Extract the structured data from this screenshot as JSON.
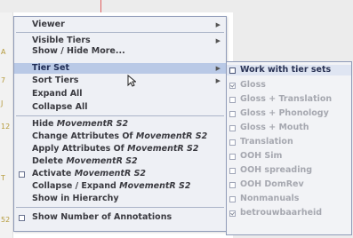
{
  "background": {
    "strip_marks": [
      "A",
      "7",
      "J",
      "12",
      "T",
      "52"
    ]
  },
  "menu": {
    "items": [
      {
        "label": "Viewer",
        "has_submenu": true
      },
      {
        "label": "Visible Tiers",
        "has_submenu": true
      },
      {
        "label": "Show / Hide More..."
      },
      {
        "label": "Tier Set",
        "has_submenu": true,
        "selected": true
      },
      {
        "label": "Sort Tiers",
        "has_submenu": true
      },
      {
        "label": "Expand All"
      },
      {
        "label": "Collapse All"
      },
      {
        "prefix": "Hide ",
        "tier": "MovementR S2"
      },
      {
        "prefix": "Change Attributes Of ",
        "tier": "MovementR S2"
      },
      {
        "prefix": "Apply Attributes Of ",
        "tier": "MovementR S2"
      },
      {
        "prefix": "Delete ",
        "tier": "MovementR S2"
      },
      {
        "prefix": "Activate ",
        "tier": "MovementR S2",
        "checkbox": true
      },
      {
        "prefix": "Collapse / Expand ",
        "tier": "MovementR S2"
      },
      {
        "label": "Show in Hierarchy"
      },
      {
        "label": "Show Number of Annotations",
        "checkbox": true
      }
    ]
  },
  "submenu": {
    "items": [
      {
        "label": "Work with tier sets",
        "enabled": true,
        "checked": false
      },
      {
        "label": "Gloss",
        "enabled": false,
        "checked": true
      },
      {
        "label": "Gloss + Translation",
        "enabled": false,
        "checked": false
      },
      {
        "label": "Gloss + Phonology",
        "enabled": false,
        "checked": false
      },
      {
        "label": "Gloss + Mouth",
        "enabled": false,
        "checked": false
      },
      {
        "label": "Translation",
        "enabled": false,
        "checked": false
      },
      {
        "label": "OOH Sim",
        "enabled": false,
        "checked": false
      },
      {
        "label": "OOH spreading",
        "enabled": false,
        "checked": false
      },
      {
        "label": "OOH DomRev",
        "enabled": false,
        "checked": false
      },
      {
        "label": "Nonmanuals",
        "enabled": false,
        "checked": false
      },
      {
        "label": "betrouwbaarheid",
        "enabled": false,
        "checked": true
      }
    ]
  },
  "colors": {
    "menu_bg": "#eef0f5",
    "selected_bg": "#b9c9e6",
    "disabled_text": "#a6a8b0"
  }
}
